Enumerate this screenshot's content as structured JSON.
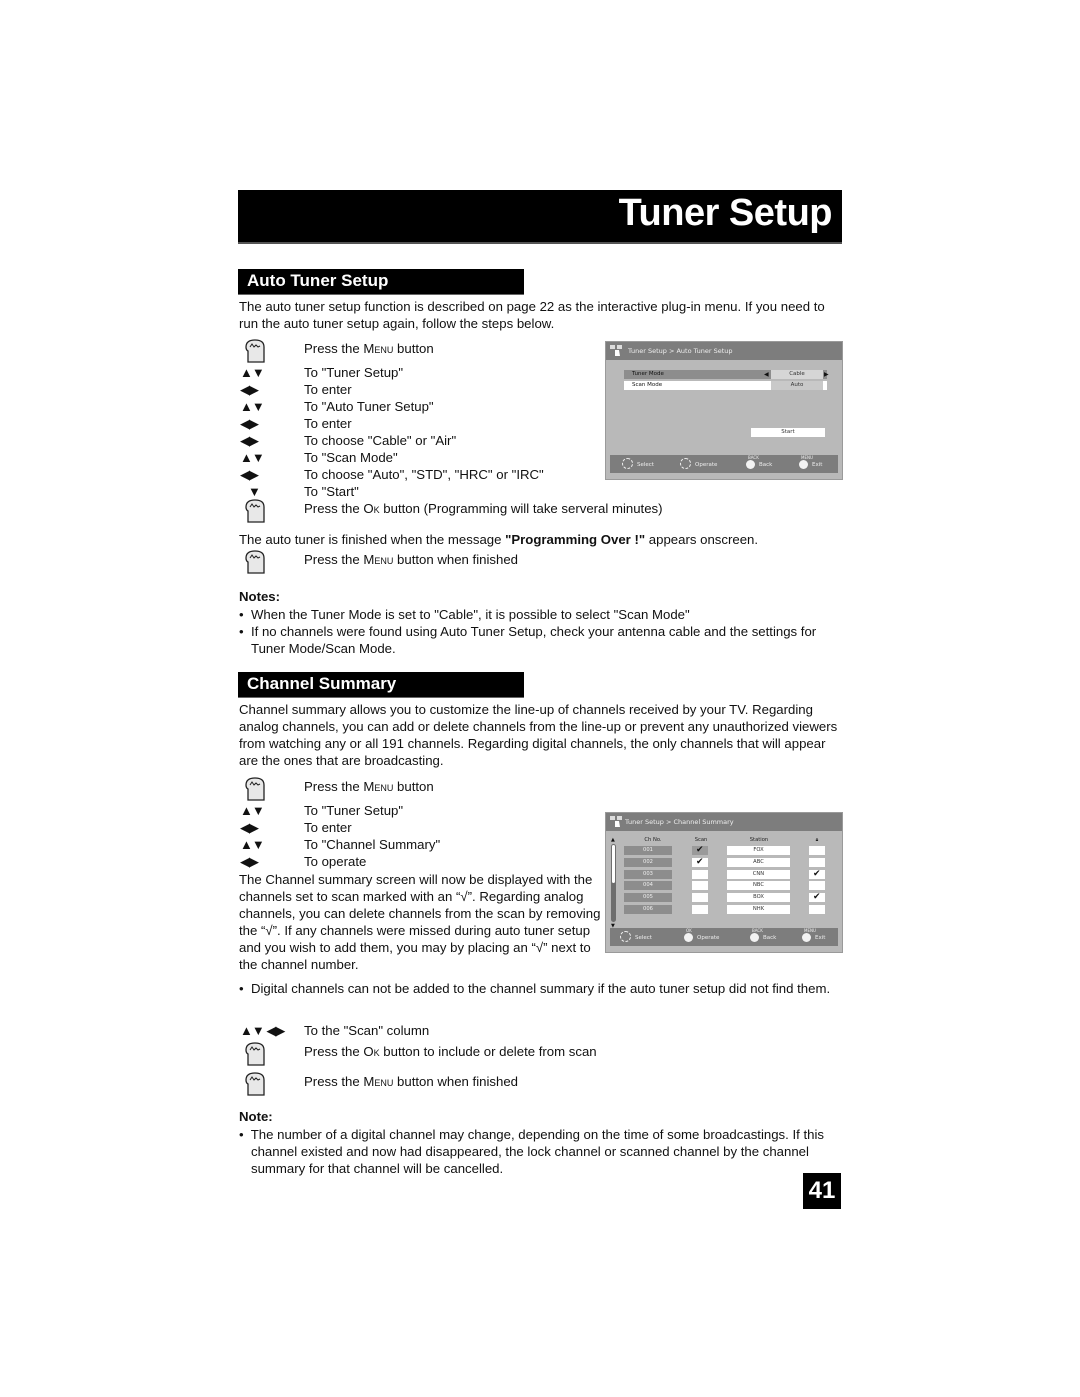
{
  "page": {
    "title": "Tuner Setup",
    "page_number": "41"
  },
  "auto_tuner": {
    "heading": "Auto Tuner Setup",
    "intro": "The auto tuner setup function is described on page 22 as the interactive plug-in menu.  If you need to run the auto tuner setup again, follow the steps below.",
    "steps": [
      {
        "icon": "hand-press-icon",
        "prefix": "Press the ",
        "key": "Menu",
        "suffix": " button"
      },
      {
        "icon": "up-down-arrows-icon",
        "glyph": "▲▼",
        "text": "To \"Tuner Setup\""
      },
      {
        "icon": "left-right-arrows-icon",
        "glyph": "◀▶",
        "text": "To enter"
      },
      {
        "icon": "up-down-arrows-icon",
        "glyph": "▲▼",
        "text": "To \"Auto Tuner Setup\""
      },
      {
        "icon": "left-right-arrows-icon",
        "glyph": "◀▶",
        "text": "To enter"
      },
      {
        "icon": "left-right-arrows-icon",
        "glyph": "◀▶",
        "text": "To choose \"Cable\" or \"Air\""
      },
      {
        "icon": "up-down-arrows-icon",
        "glyph": "▲▼",
        "text": "To \"Scan Mode\""
      },
      {
        "icon": "left-right-arrows-icon",
        "glyph": "◀▶",
        "text": "To choose \"Auto\", \"STD\", \"HRC\" or \"IRC\""
      },
      {
        "icon": "down-arrow-icon",
        "glyph": "▼",
        "text": "To \"Start\""
      },
      {
        "icon": "hand-press-icon",
        "prefix": "Press the ",
        "key": "Ok",
        "suffix": " button (Programming will take serveral minutes)"
      }
    ],
    "finish_pre": "The auto tuner is finished when the message ",
    "finish_bold": "\"Programming Over !\"",
    "finish_post": " appears onscreen.",
    "finish_step": {
      "prefix": "Press the ",
      "key": "Menu",
      "suffix": " button when finished"
    },
    "notes_heading": "Notes:",
    "notes": [
      "When the Tuner Mode is set to \"Cable\", it is possible to select \"Scan Mode\"",
      "If no channels were found using Auto Tuner Setup, check your antenna cable and the settings for Tuner Mode/Scan Mode."
    ],
    "screen": {
      "breadcrumb": "Tuner Setup > Auto Tuner Setup",
      "rows": [
        {
          "label": "Tuner Mode",
          "value": "Cable"
        },
        {
          "label": "Scan Mode",
          "value": "Auto"
        }
      ],
      "start_label": "Start",
      "footer": [
        {
          "label": "Select",
          "sup": ""
        },
        {
          "label": "Operate",
          "sup": ""
        },
        {
          "label": "Back",
          "sup": "BACK"
        },
        {
          "label": "Exit",
          "sup": "MENU"
        }
      ]
    }
  },
  "channel_summary": {
    "heading": "Channel Summary",
    "intro": "Channel summary allows you to customize the line-up of channels received by your TV. Regarding analog channels, you can add or delete channels from the line-up or prevent any unauthorized viewers from watching any or all 191 channels.  Regarding digital channels, the only channels that will appear are the ones that are broadcasting.",
    "steps": [
      {
        "icon": "hand-press-icon",
        "prefix": "Press the ",
        "key": "Menu",
        "suffix": " button"
      },
      {
        "icon": "up-down-arrows-icon",
        "glyph": "▲▼",
        "text": "To \"Tuner Setup\""
      },
      {
        "icon": "left-right-arrows-icon",
        "glyph": "◀▶",
        "text": "To enter"
      },
      {
        "icon": "up-down-arrows-icon",
        "glyph": "▲▼",
        "text": "To \"Channel Summary\""
      },
      {
        "icon": "left-right-arrows-icon",
        "glyph": "◀▶",
        "text": "To operate"
      }
    ],
    "explain": "The Channel summary screen will now be displayed with the channels set to scan marked with an “√”. Regarding analog channels, you can delete channels from the scan by removing the “√”. If any channels were missed during auto tuner setup and you wish to add them, you may by placing an “√” next to the channel number.",
    "digital_note": "Digital channels can not be added to the channel summary if the auto tuner setup did not find them.",
    "steps2": [
      {
        "icon": "all-arrows-icon",
        "glyph": "▲▼ ◀▶",
        "text": "To the \"Scan\" column"
      },
      {
        "icon": "hand-press-icon",
        "prefix": "Press the ",
        "key": "Ok",
        "suffix": " button to include or delete from scan"
      },
      {
        "icon": "hand-press-icon",
        "prefix": "Press the ",
        "key": "Menu",
        "suffix": " button when finished"
      }
    ],
    "note_heading": "Note:",
    "note": "The number of a digital channel may change, depending on the time of some broadcastings. If this channel existed and now had disappeared, the lock channel or scanned channel by the channel summary for that channel will be cancelled.",
    "screen": {
      "breadcrumb": "Tuner Setup > Channel Summary",
      "columns": [
        "Ch No.",
        "Scan",
        "Station",
        "lock"
      ],
      "rows": [
        {
          "ch": "001",
          "scan": true,
          "station": "FOX",
          "lock": false
        },
        {
          "ch": "002",
          "scan": true,
          "station": "ABC",
          "lock": false
        },
        {
          "ch": "003",
          "scan": false,
          "station": "CNN",
          "lock": true
        },
        {
          "ch": "004",
          "scan": false,
          "station": "NBC",
          "lock": false
        },
        {
          "ch": "005",
          "scan": false,
          "station": "BOX",
          "lock": true
        },
        {
          "ch": "006",
          "scan": false,
          "station": "NHK",
          "lock": false
        }
      ],
      "check_glyph": "✔",
      "footer": [
        {
          "label": "Select",
          "sup": ""
        },
        {
          "label": "Operate",
          "sup": "OK"
        },
        {
          "label": "Back",
          "sup": "BACK"
        },
        {
          "label": "Exit",
          "sup": "MENU"
        }
      ]
    }
  }
}
